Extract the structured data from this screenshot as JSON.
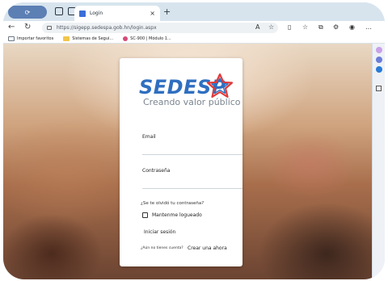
{
  "browser": {
    "tab_title": "Login",
    "tab_close": "×",
    "new_tab": "+",
    "url": "https://sigepp.sedespa.gob.hn/login.aspx",
    "favorites": [
      {
        "label": "Importar favoritos",
        "icon": "import-icon",
        "color": "#6b7785"
      },
      {
        "label": "Sistemas de Segui...",
        "icon": "folder-icon",
        "color": "#f2c64b"
      },
      {
        "label": "SC-900 | Módulo 1...",
        "icon": "module-icon",
        "color": "#d34b7a"
      }
    ]
  },
  "login": {
    "brand": "SEDESP",
    "tagline": "Creando valor público",
    "email_label": "Email",
    "password_label": "Contraseña",
    "forgot_password": "¿Se te olvidó tu contraseña?",
    "remember_label": "Mantenme logueado",
    "login_button": "Iniciar sesión",
    "no_account_text": "¿Aún no tienes cuenta?",
    "create_account_link": "Crear una ahora"
  },
  "colors": {
    "brand_blue": "#2f6fc0",
    "brand_red": "#e23a3a"
  }
}
